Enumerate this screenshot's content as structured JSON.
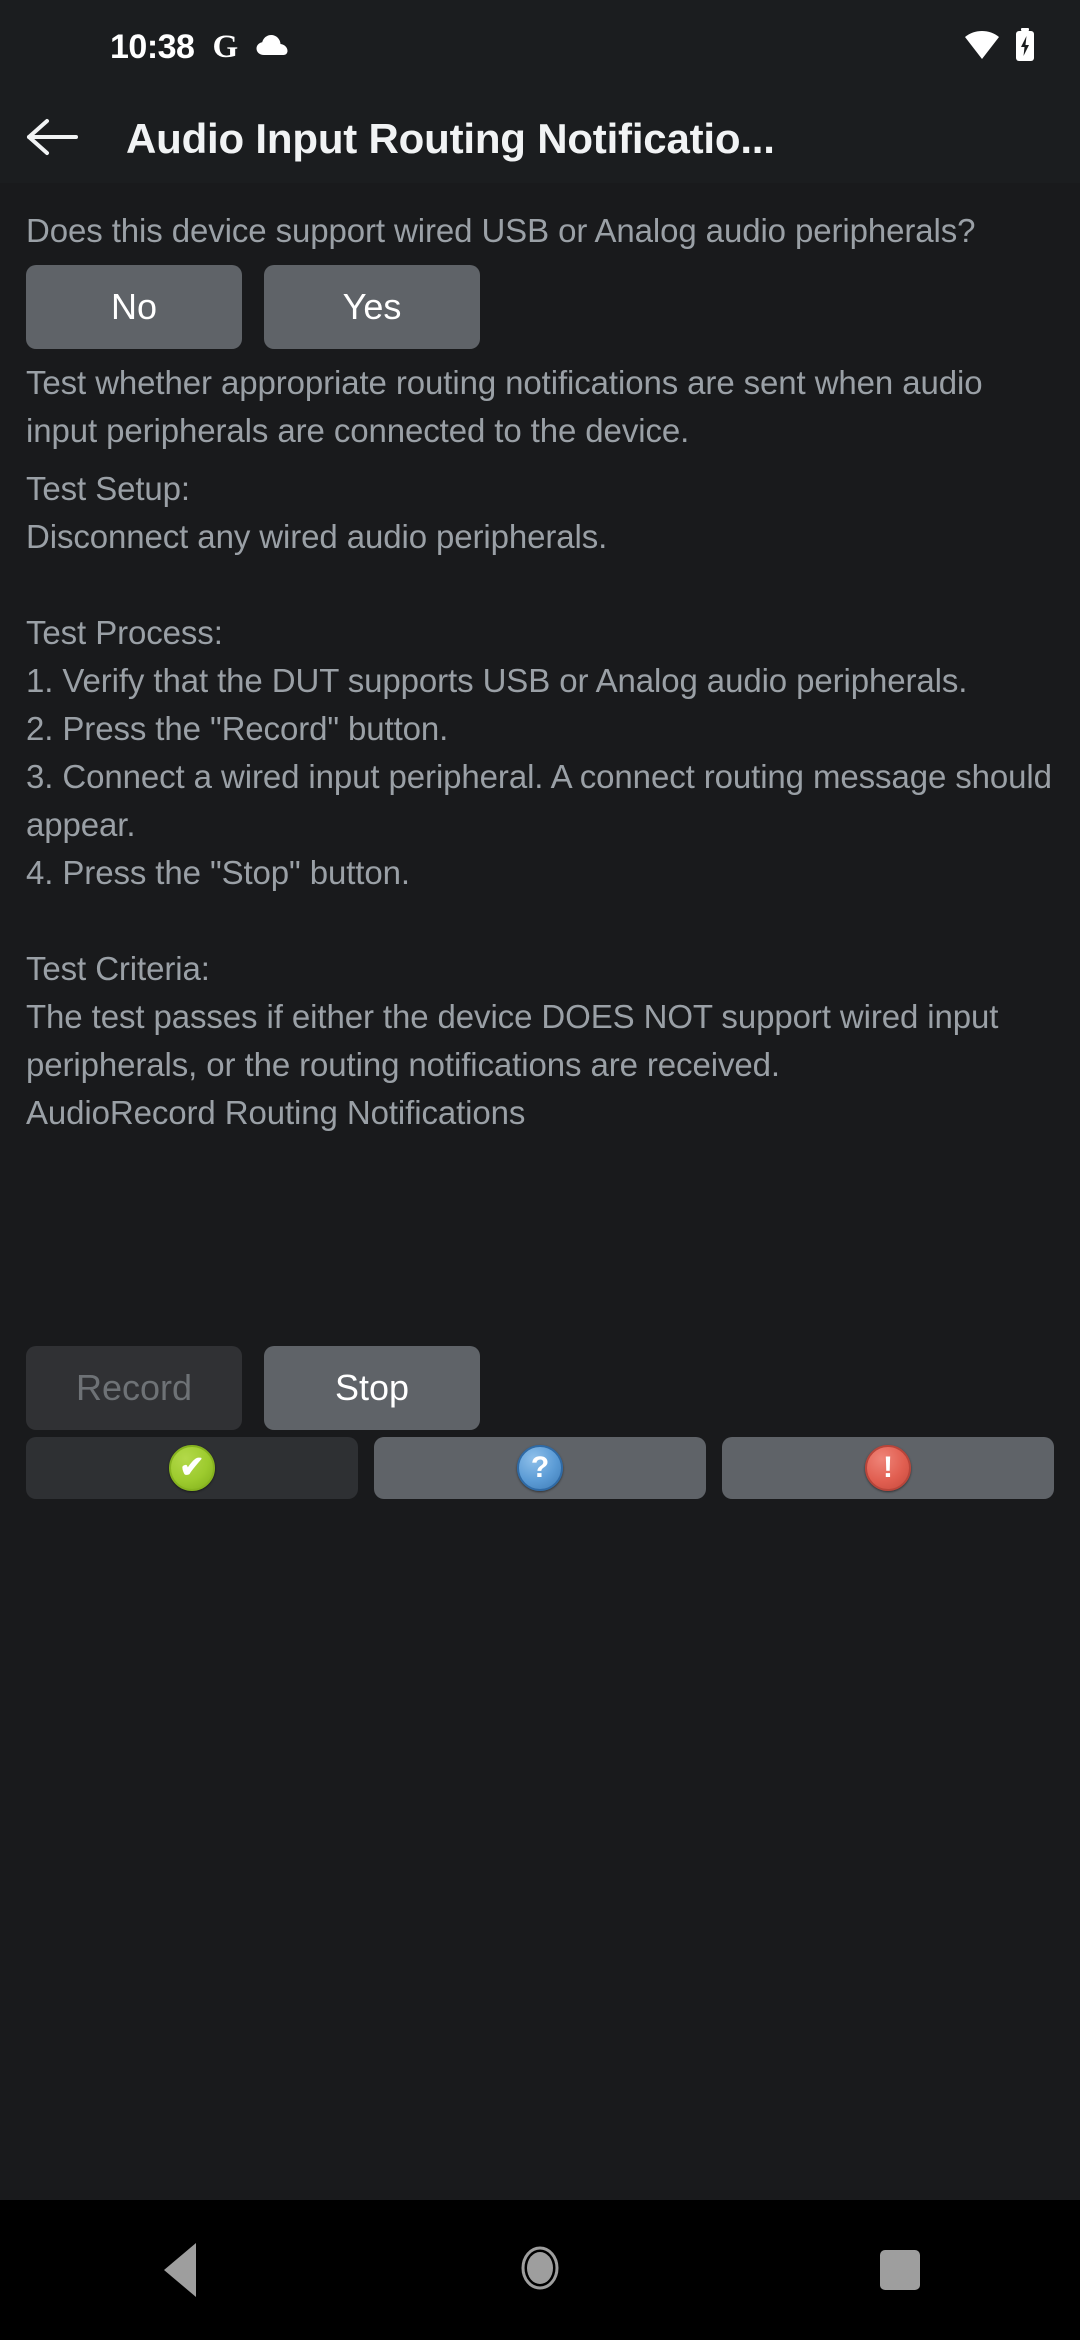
{
  "status_bar": {
    "time": "10:38",
    "icons": [
      "google-g-icon",
      "cloud-icon",
      "wifi-icon",
      "battery-charging-icon"
    ]
  },
  "app_bar": {
    "back_icon": "arrow-back-icon",
    "title": "Audio Input Routing Notificatio..."
  },
  "main": {
    "question": "Does this device support wired USB or Analog audio peripherals?",
    "answer_buttons": [
      {
        "label": "No",
        "state": "enabled"
      },
      {
        "label": "Yes",
        "state": "enabled"
      }
    ],
    "description": "Test whether appropriate routing notifications are sent when audio input peripherals are connected to the device.",
    "instructions": "Test Setup:\nDisconnect any wired audio peripherals.\n\nTest Process:\n1. Verify that the DUT supports USB or Analog audio peripherals.\n2. Press the \"Record\" button.\n3. Connect a wired input peripheral. A connect routing message should appear.\n4. Press the \"Stop\" button.\n\nTest Criteria:\nThe test passes if either the device DOES NOT support wired input peripherals, or the routing notifications are received.",
    "status_line": "AudioRecord Routing Notifications",
    "action_buttons": [
      {
        "label": "Record",
        "state": "disabled"
      },
      {
        "label": "Stop",
        "state": "enabled"
      }
    ],
    "verdict_buttons": [
      {
        "name": "pass-button",
        "icon": "check-circle-icon",
        "glyph": "✔",
        "state": "disabled",
        "color": "#9dcb2e"
      },
      {
        "name": "info-button",
        "icon": "question-circle-icon",
        "glyph": "?",
        "state": "enabled",
        "color": "#5b9bd5"
      },
      {
        "name": "fail-button",
        "icon": "exclamation-circle-icon",
        "glyph": "!",
        "state": "enabled",
        "color": "#e15f51"
      }
    ]
  },
  "nav_bar": {
    "back": "nav-back-icon",
    "home": "nav-home-icon",
    "recents": "nav-recents-icon"
  }
}
